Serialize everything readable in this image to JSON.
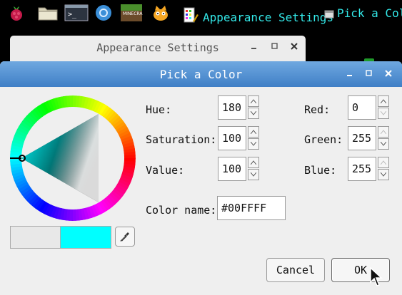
{
  "taskbar": {
    "tasks": [
      {
        "label": "Appearance Settings"
      },
      {
        "label": "Pick a Color"
      }
    ]
  },
  "back_window": {
    "title": "Appearance Settings"
  },
  "dialog": {
    "title": "Pick a Color",
    "fields": {
      "hue": {
        "label": "Hue:",
        "value": "180"
      },
      "saturation": {
        "label": "Saturation:",
        "value": "100"
      },
      "value": {
        "label": "Value:",
        "value": "100"
      },
      "red": {
        "label": "Red:",
        "value": "0"
      },
      "green": {
        "label": "Green:",
        "value": "255"
      },
      "blue": {
        "label": "Blue:",
        "value": "255"
      }
    },
    "color_name": {
      "label": "Color name:",
      "value": "#00FFFF"
    },
    "selected_color": "#00FFFF",
    "previous_color": "#E8E8E8",
    "cancel_label": "Cancel",
    "ok_label": "OK"
  },
  "icons": [
    "raspberry-icon",
    "folder-icon",
    "terminal-icon",
    "browser-icon",
    "minecraft-icon",
    "scratch-icon",
    "appearance-icon",
    "window-icon",
    "eyedropper-icon",
    "cursor-icon"
  ]
}
